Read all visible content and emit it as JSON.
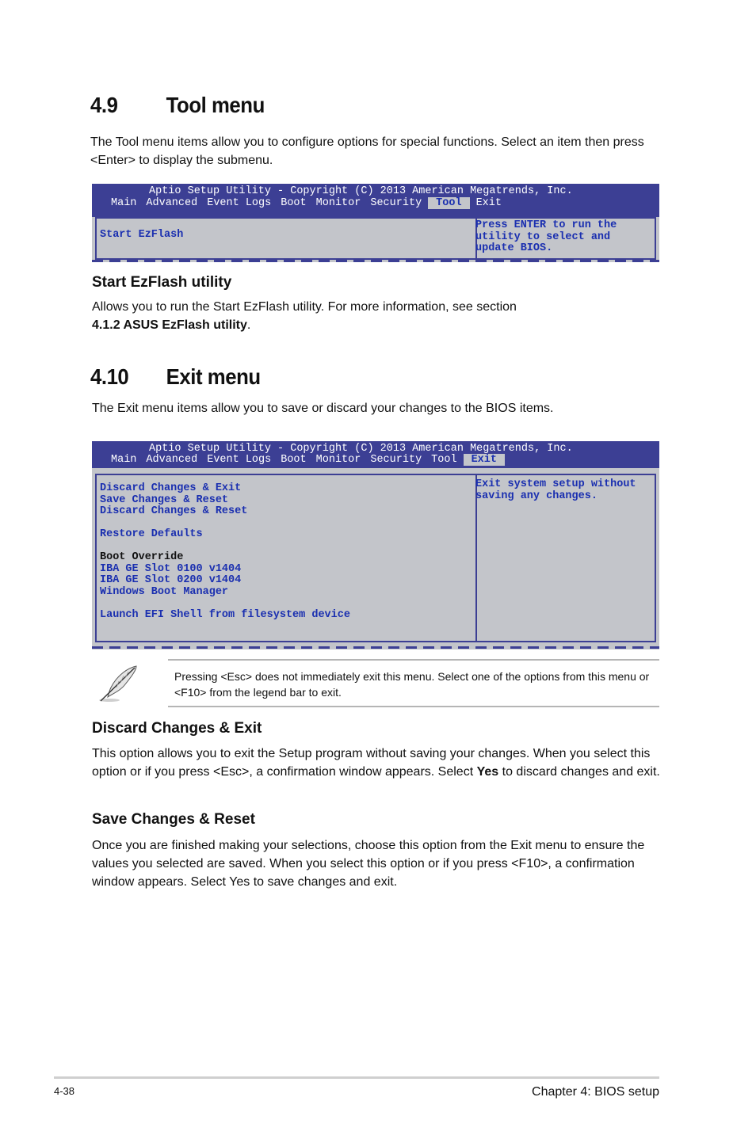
{
  "section_tool": {
    "number": "4.9",
    "title": "Tool menu",
    "intro": "The Tool menu items allow you to configure options for special functions. Select an item then press <Enter> to display the submenu."
  },
  "bios_tool": {
    "title": "Aptio Setup Utility - Copyright (C) 2013 American Megatrends, Inc.",
    "tabs": [
      "Main",
      "Advanced",
      "Event Logs",
      "Boot",
      "Monitor",
      "Security",
      "Tool",
      "Exit"
    ],
    "active_tab": "Tool",
    "items": [
      "Start EzFlash"
    ],
    "help": "Press ENTER to run the\nutility to select and\nupdate BIOS."
  },
  "start_ezflash": {
    "heading": "Start EzFlash utility",
    "text": "Allows you to run the Start EzFlash utility. For more information, see section",
    "ref_bold": "4.1.2 ASUS EzFlash utility",
    "ref_end": "."
  },
  "section_exit": {
    "number": "4.10",
    "title": "Exit menu",
    "intro": "The Exit menu items allow you to save or discard your changes to the BIOS items."
  },
  "bios_exit": {
    "title": "Aptio Setup Utility - Copyright (C) 2013 American Megatrends, Inc.",
    "tabs": [
      "Main",
      "Advanced",
      "Event Logs",
      "Boot",
      "Monitor",
      "Security",
      "Tool",
      "Exit"
    ],
    "active_tab": "Exit",
    "items": [
      "Discard Changes & Exit",
      "Save Changes & Reset",
      "Discard Changes & Reset",
      "",
      "Restore Defaults",
      "",
      "Boot Override",
      "IBA GE Slot 0100 v1404",
      "IBA GE Slot 0200 v1404",
      "Windows Boot Manager",
      "",
      "Launch EFI Shell from filesystem device"
    ],
    "help": "Exit system setup without\nsaving any changes."
  },
  "note": {
    "icon": "feather-pen-icon",
    "text": "Pressing <Esc> does not immediately exit this menu. Select one of the options from this menu or <F10> from the legend bar to exit."
  },
  "discard_exit": {
    "heading": "Discard Changes & Exit",
    "text_before": "This option allows you to exit the Setup program without saving your changes. When you select this option or if you press <Esc>, a confirmation window appears. Select ",
    "bold": "Yes",
    "text_after": " to discard changes and exit."
  },
  "save_reset": {
    "heading": "Save Changes & Reset",
    "text": "Once you are finished making your selections, choose this option from the Exit menu to ensure the values you selected are saved. When you select this option or if you press <F10>, a confirmation window appears. Select Yes to save changes and exit."
  },
  "footer": {
    "page_number": "4-38",
    "chapter": "Chapter 4: BIOS setup"
  },
  "colors": {
    "bios_header": "#3c3f94",
    "bios_background": "#c3c5ca",
    "bios_item_text": "#1a2fb0"
  }
}
